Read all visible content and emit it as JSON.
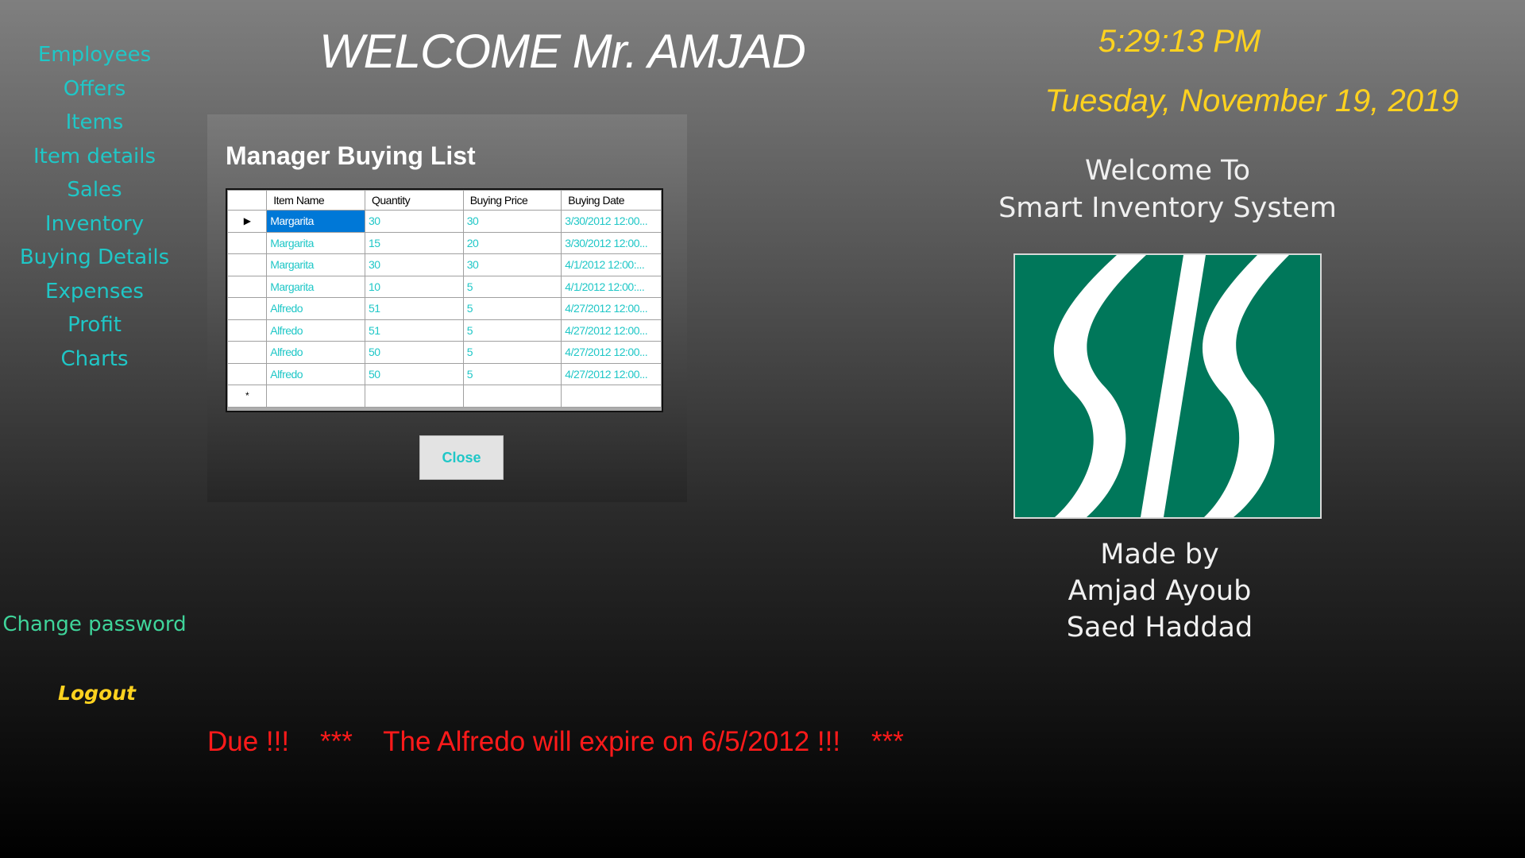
{
  "header": {
    "welcome": "WELCOME Mr. AMJAD",
    "time": "5:29:13 PM",
    "date": "Tuesday, November 19, 2019"
  },
  "sidebar": {
    "items": [
      {
        "label": "Employees"
      },
      {
        "label": "Offers"
      },
      {
        "label": "Items"
      },
      {
        "label": "Item details"
      },
      {
        "label": "Sales"
      },
      {
        "label": "Inventory"
      },
      {
        "label": "Buying Details"
      },
      {
        "label": "Expenses"
      },
      {
        "label": "Profit"
      },
      {
        "label": "Charts"
      }
    ],
    "change_password": "Change password",
    "logout": "Logout"
  },
  "welcome_panel": {
    "line1": "Welcome To",
    "line2": "Smart Inventory System",
    "logo_icon": "sis-logo",
    "made_by": "Made by",
    "author1": "Amjad Ayoub",
    "author2": "Saed Haddad"
  },
  "dialog": {
    "title": "Manager Buying List",
    "columns": [
      "Item Name",
      "Quantity",
      "Buying Price",
      "Buying Date"
    ],
    "rows": [
      [
        "Margarita",
        "30",
        "30",
        "3/30/2012 12:00..."
      ],
      [
        "Margarita",
        "15",
        "20",
        "3/30/2012 12:00..."
      ],
      [
        "Margarita",
        "30",
        "30",
        "4/1/2012 12:00:..."
      ],
      [
        "Margarita",
        "10",
        "5",
        "4/1/2012 12:00:..."
      ],
      [
        "Alfredo",
        "51",
        "5",
        "4/27/2012 12:00..."
      ],
      [
        "Alfredo",
        "51",
        "5",
        "4/27/2012 12:00..."
      ],
      [
        "Alfredo",
        "50",
        "5",
        "4/27/2012 12:00..."
      ],
      [
        "Alfredo",
        "50",
        "5",
        "4/27/2012 12:00..."
      ]
    ],
    "current_row_marker": "▶",
    "new_row_marker": "*",
    "close_label": "Close"
  },
  "ticker": {
    "due": "Due !!!",
    "stars_left": "***",
    "message": "The Alfredo will expire on 6/5/2012 !!!",
    "stars_right": "***"
  },
  "colors": {
    "accent_cyan": "#1fc7c7",
    "clock_yellow": "#ffd21f",
    "alert_red": "#ff1a1a",
    "logo_green": "#00775a"
  }
}
